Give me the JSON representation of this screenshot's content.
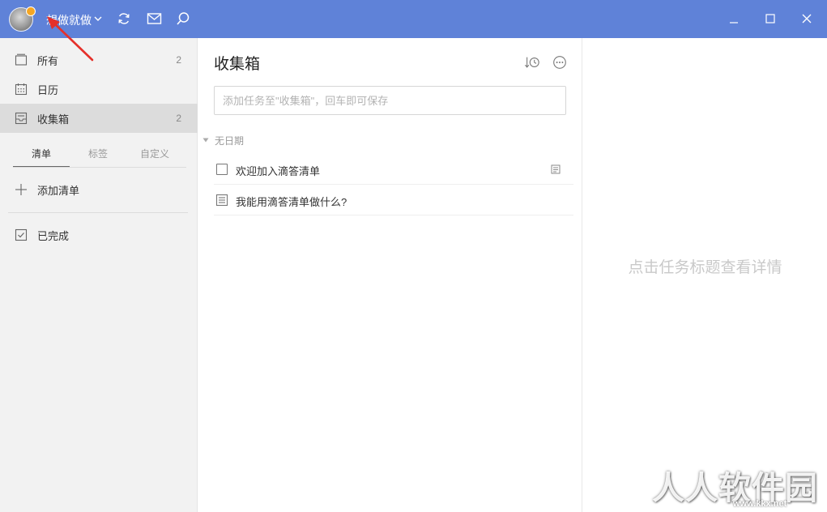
{
  "titlebar": {
    "username": "想做就做",
    "icons": [
      "sync-icon",
      "mail-icon",
      "search-icon"
    ],
    "window_controls": [
      "minimize-icon",
      "maximize-icon",
      "close-icon"
    ],
    "background_color": "#5f82d8"
  },
  "sidebar": {
    "items": [
      {
        "label": "所有",
        "count": "2",
        "icon": "all-tasks-icon"
      },
      {
        "label": "日历",
        "count": "",
        "icon": "calendar-icon"
      },
      {
        "label": "收集箱",
        "count": "2",
        "icon": "inbox-icon",
        "active": true
      }
    ],
    "tabs": [
      {
        "label": "清单",
        "active": true
      },
      {
        "label": "标签",
        "active": false
      },
      {
        "label": "自定义",
        "active": false
      }
    ],
    "add_list_label": "添加清单",
    "completed_label": "已完成"
  },
  "main": {
    "title": "收集箱",
    "sort_icon": "sort-by-time-icon",
    "more_icon": "more-options-icon",
    "input_placeholder": "添加任务至\"收集箱\"，回车即可保存",
    "group_label": "无日期",
    "tasks": [
      {
        "title": "欢迎加入滴答清单",
        "type": "checkbox",
        "has_note": true
      },
      {
        "title": "我能用滴答清单做什么?",
        "type": "note",
        "has_note": false
      }
    ]
  },
  "detail": {
    "hint": "点击任务标题查看详情"
  },
  "watermark": {
    "brand": "人人软件园",
    "url": "www.kkx.net"
  }
}
